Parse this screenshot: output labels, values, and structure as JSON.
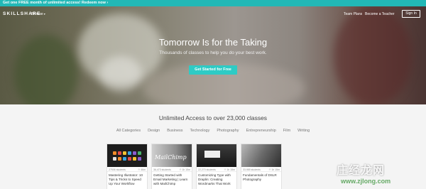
{
  "promo_bar": {
    "text": "Get one FREE month of unlimited access! Redeem now ›"
  },
  "nav": {
    "logo": "SKILLSHARE",
    "browse_label": "Browse",
    "team_plans": "Team Plans",
    "become_teacher": "Become a Teacher",
    "sign_in": "Sign In"
  },
  "hero": {
    "title": "Tomorrow Is for the Taking",
    "subtitle": "Thousands of classes to help you do your best work.",
    "cta": "Get Started for Free"
  },
  "section": {
    "title": "Unlimited Access to over 23,000 classes",
    "categories": [
      "All Categories",
      "Design",
      "Business",
      "Technology",
      "Photography",
      "Entrepreneurship",
      "Film",
      "Writing"
    ]
  },
  "cards": [
    {
      "students": "27506 students",
      "duration": "46m",
      "title": "Mastering Illustrator: 10 Tips & Tricks to Speed Up Your Workflow"
    },
    {
      "students": "36,473 students",
      "duration": "1h 15m",
      "title": "Getting Started with Email Marketing | Learn with MailChimp",
      "thumb_text": "MailChimp"
    },
    {
      "students": "22,270 students",
      "duration": "1h 15m",
      "title": "Customizing Type with Draplin: Creating Wordmarks That Work"
    },
    {
      "students": "33,985 students",
      "duration": "1h 15m",
      "title": "Fundamentals of DSLR Photography"
    }
  ],
  "watermark": {
    "text": "庄经龙网",
    "url": "www.zjlong.com"
  },
  "colors": {
    "accent": "#2ecbc5",
    "promo_bg": "#22b8b6"
  }
}
